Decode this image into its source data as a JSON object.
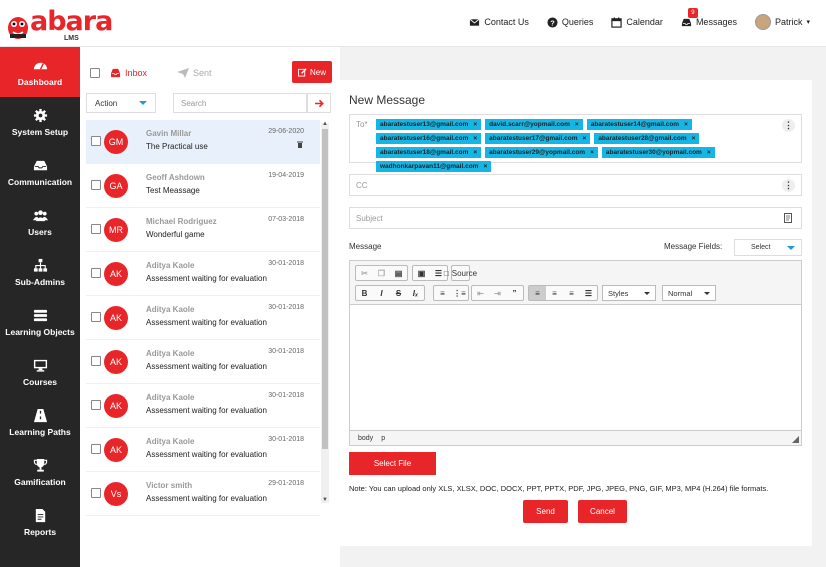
{
  "brand": {
    "word": "abara",
    "sub": "LMS",
    "color": "#e8262a"
  },
  "topnav": {
    "contact": "Contact Us",
    "queries": "Queries",
    "calendar": "Calendar",
    "messages": "Messages",
    "messages_count": "9",
    "user": "Patrick"
  },
  "sidebar": [
    {
      "label": "Dashboard",
      "icon": "dashboard-icon",
      "active": true
    },
    {
      "label": "System Setup",
      "icon": "gear-icon"
    },
    {
      "label": "Communication",
      "icon": "inbox-icon"
    },
    {
      "label": "Users",
      "icon": "users-icon"
    },
    {
      "label": "Sub-Admins",
      "icon": "org-chart-icon"
    },
    {
      "label": "Learning Objects",
      "icon": "stack-icon"
    },
    {
      "label": "Courses",
      "icon": "monitor-icon"
    },
    {
      "label": "Learning Paths",
      "icon": "road-icon"
    },
    {
      "label": "Gamification",
      "icon": "trophy-icon"
    },
    {
      "label": "Reports",
      "icon": "report-icon"
    }
  ],
  "folders": {
    "inbox": "Inbox",
    "sent": "Sent",
    "new": "New"
  },
  "toolbar": {
    "action": "Action",
    "search_placeholder": "Search"
  },
  "messages": [
    {
      "initials": "GM",
      "name": "Gavin Millar",
      "subject": "The Practical use",
      "date": "29-06-2020",
      "selected": true
    },
    {
      "initials": "GA",
      "name": "Geoff Ashdown",
      "subject": "Test Meassage",
      "date": "19-04-2019"
    },
    {
      "initials": "MR",
      "name": "Michael Rodriguez",
      "subject": "Wonderful game",
      "date": "07-03-2018"
    },
    {
      "initials": "AK",
      "name": "Aditya Kaole",
      "subject": "Assessment waiting for evaluation",
      "date": "30-01-2018"
    },
    {
      "initials": "AK",
      "name": "Aditya Kaole",
      "subject": "Assessment waiting for evaluation",
      "date": "30-01-2018"
    },
    {
      "initials": "AK",
      "name": "Aditya Kaole",
      "subject": "Assessment waiting for evaluation",
      "date": "30-01-2018"
    },
    {
      "initials": "AK",
      "name": "Aditya Kaole",
      "subject": "Assessment waiting for evaluation",
      "date": "30-01-2018"
    },
    {
      "initials": "AK",
      "name": "Aditya Kaole",
      "subject": "Assessment waiting for evaluation",
      "date": "30-01-2018"
    },
    {
      "initials": "Vs",
      "name": "Victor smith",
      "subject": "Assessment waiting for evaluation",
      "date": "29-01-2018"
    }
  ],
  "compose": {
    "title": "New Message",
    "to_label": "To*",
    "recipients": [
      "abaratestuser13@gmail.com",
      "david.scarr@yopmail.com",
      "abaratestuser14@gmail.com",
      "abaratestuser16@gmail.com",
      "abaratestuser17@gmail.com",
      "abaratestuser28@gmail.com",
      "abaratestuser18@gmail.com",
      "abaratestuser29@yopmail.com",
      "abaratestuser30@yopmail.com",
      "wadhonkarpavan11@gmail.com"
    ],
    "cc_placeholder": "CC",
    "subject_placeholder": "Subject",
    "message_label": "Message",
    "fields_label": "Message Fields:",
    "fields_select": "Select",
    "source": "Source",
    "styles": "Styles",
    "format": "Normal",
    "path": [
      "body",
      "p"
    ],
    "select_file": "Select File",
    "note": "Note: You can upload only XLS, XLSX, DOC, DOCX, PPT, PPTX, PDF, JPG, JPEG, PNG, GIF, MP3, MP4 (H.264) file formats.",
    "send": "Send",
    "cancel": "Cancel"
  }
}
